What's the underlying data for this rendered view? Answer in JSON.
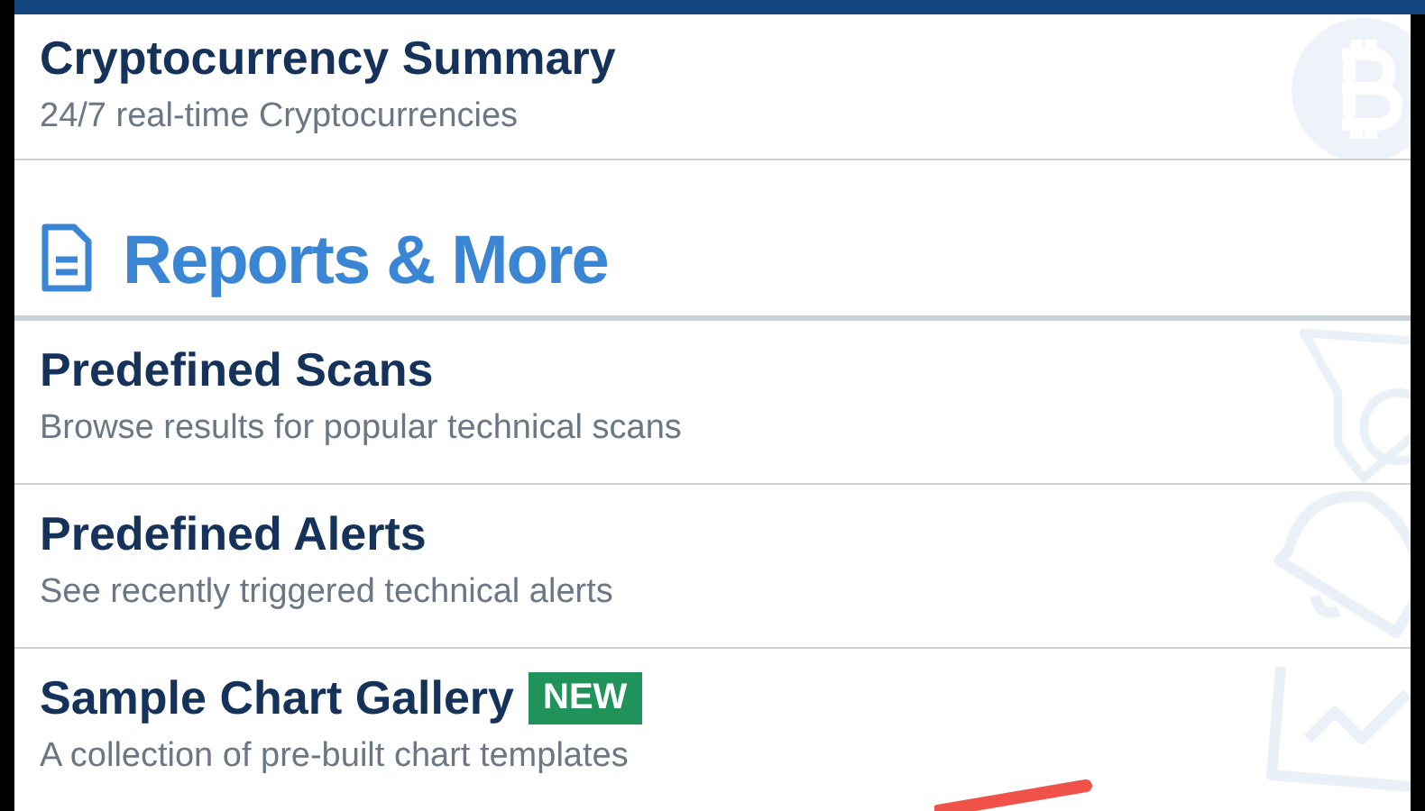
{
  "list": [
    {
      "kind": "item",
      "title": "Cryptocurrency Summary",
      "subtitle": "24/7 real-time Cryptocurrencies"
    },
    {
      "kind": "section",
      "title": "Reports & More"
    },
    {
      "kind": "item",
      "title": "Predefined Scans",
      "subtitle": "Browse results for popular technical scans"
    },
    {
      "kind": "item",
      "title": "Predefined Alerts",
      "subtitle": "See recently triggered technical alerts"
    },
    {
      "kind": "item",
      "title": "Sample Chart Gallery",
      "badge": "NEW",
      "subtitle": "A collection of pre-built chart templates"
    }
  ]
}
